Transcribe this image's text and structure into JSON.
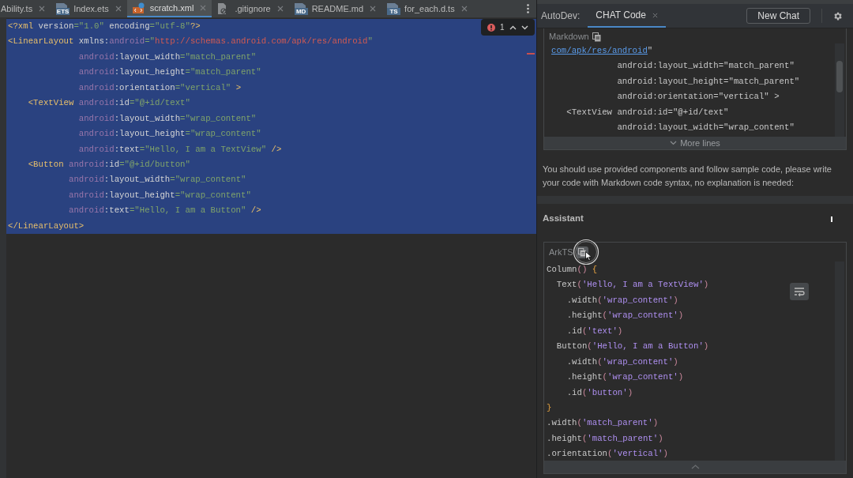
{
  "tabs": [
    {
      "label": "Ability.ts",
      "selected": false
    },
    {
      "label": "Index.ets",
      "selected": false,
      "kind": "ets",
      "icon_label": "ETS"
    },
    {
      "label": "scratch.xml",
      "selected": true,
      "kind": "xml"
    },
    {
      "label": ".gitignore",
      "selected": false,
      "kind": "ignore"
    },
    {
      "label": "README.md",
      "selected": false,
      "kind": "md",
      "icon_label": "MD"
    },
    {
      "label": "for_each.d.ts",
      "selected": false,
      "kind": "ts",
      "icon_label": "TS"
    }
  ],
  "editor": {
    "problems": {
      "count": "1"
    },
    "lines": [
      {
        "selected": true,
        "tokens": [
          {
            "kind": "tag",
            "text": "<?xml "
          },
          {
            "kind": "attr",
            "text": "version"
          },
          {
            "kind": "string",
            "text": "=\"1.0\""
          },
          {
            "kind": "attr",
            "text": " encoding"
          },
          {
            "kind": "string",
            "text": "=\"utf-8\""
          },
          {
            "kind": "tag",
            "text": "?>"
          }
        ]
      },
      {
        "selected": true,
        "tokens": [
          {
            "kind": "tag",
            "text": "<LinearLayout "
          },
          {
            "kind": "attr",
            "text": "xmlns:"
          },
          {
            "kind": "ns",
            "text": "android"
          },
          {
            "kind": "string",
            "text": "=\""
          },
          {
            "kind": "url",
            "text": "http://schemas.android.com/apk/res/android"
          },
          {
            "kind": "string",
            "text": "\""
          }
        ]
      },
      {
        "selected": true,
        "tokens": [
          {
            "kind": "ns",
            "text": "              android"
          },
          {
            "kind": "attr",
            "text": ":layout_width"
          },
          {
            "kind": "string",
            "text": "=\"match_parent\""
          }
        ]
      },
      {
        "selected": true,
        "tokens": [
          {
            "kind": "ns",
            "text": "              android"
          },
          {
            "kind": "attr",
            "text": ":layout_height"
          },
          {
            "kind": "string",
            "text": "=\"match_parent\""
          }
        ]
      },
      {
        "selected": true,
        "tokens": [
          {
            "kind": "ns",
            "text": "              android"
          },
          {
            "kind": "attr",
            "text": ":orientation"
          },
          {
            "kind": "string",
            "text": "=\"vertical\""
          },
          {
            "kind": "tag",
            "text": " >"
          }
        ]
      },
      {
        "selected": true,
        "tokens": [
          {
            "kind": "tag",
            "text": "    <TextView "
          },
          {
            "kind": "ns",
            "text": "android"
          },
          {
            "kind": "attr",
            "text": ":id"
          },
          {
            "kind": "string",
            "text": "=\"@+id/text\""
          }
        ]
      },
      {
        "selected": true,
        "tokens": [
          {
            "kind": "ns",
            "text": "              android"
          },
          {
            "kind": "attr",
            "text": ":layout_width"
          },
          {
            "kind": "string",
            "text": "=\"wrap_content\""
          }
        ]
      },
      {
        "selected": true,
        "tokens": [
          {
            "kind": "ns",
            "text": "              android"
          },
          {
            "kind": "attr",
            "text": ":layout_height"
          },
          {
            "kind": "string",
            "text": "=\"wrap_content\""
          }
        ]
      },
      {
        "selected": true,
        "tokens": [
          {
            "kind": "ns",
            "text": "              android"
          },
          {
            "kind": "attr",
            "text": ":text"
          },
          {
            "kind": "string",
            "text": "=\"Hello, I am a TextView\""
          },
          {
            "kind": "tag",
            "text": " />"
          }
        ]
      },
      {
        "selected": true,
        "tokens": [
          {
            "kind": "tag",
            "text": "    <Button "
          },
          {
            "kind": "ns",
            "text": "android"
          },
          {
            "kind": "attr",
            "text": ":id"
          },
          {
            "kind": "string",
            "text": "=\"@+id/button\""
          }
        ]
      },
      {
        "selected": true,
        "tokens": [
          {
            "kind": "ns",
            "text": "            android"
          },
          {
            "kind": "attr",
            "text": ":layout_width"
          },
          {
            "kind": "string",
            "text": "=\"wrap_content\""
          }
        ]
      },
      {
        "selected": true,
        "tokens": [
          {
            "kind": "ns",
            "text": "            android"
          },
          {
            "kind": "attr",
            "text": ":layout_height"
          },
          {
            "kind": "string",
            "text": "=\"wrap_content\""
          }
        ]
      },
      {
        "selected": true,
        "tokens": [
          {
            "kind": "ns",
            "text": "            android"
          },
          {
            "kind": "attr",
            "text": ":text"
          },
          {
            "kind": "string",
            "text": "=\"Hello, I am a Button\""
          },
          {
            "kind": "tag",
            "text": " />"
          }
        ]
      },
      {
        "selected": true,
        "tokens": [
          {
            "kind": "tag",
            "text": "</LinearLayout>"
          }
        ]
      }
    ]
  },
  "chat": {
    "title": "AutoDev:",
    "tabs": [
      {
        "label": "CHAT Code",
        "selected": true
      }
    ],
    "new_chat_button": "New Chat",
    "messages": [
      {
        "kind": "user",
        "code_block": {
          "language": "Markdown",
          "footer": "More lines",
          "lines": [
            [
              {
                "kind": "link",
                "text": "com/apk/res/android"
              },
              {
                "kind": "plain",
                "text": "\""
              }
            ],
            [
              {
                "kind": "plain",
                "text": "             android:layout_width=\"match_parent\""
              }
            ],
            [
              {
                "kind": "plain",
                "text": "             android:layout_height=\"match_parent\""
              }
            ],
            [
              {
                "kind": "plain",
                "text": "             android:orientation=\"vertical\" >"
              }
            ],
            [
              {
                "kind": "plain",
                "text": "   <TextView android:id=\"@+id/text\""
              }
            ],
            [
              {
                "kind": "plain",
                "text": "             android:layout_width=\"wrap_content\""
              }
            ]
          ]
        },
        "text": "You should use provided components and follow sample code, please write your code with Markdown code syntax, no explanation is needed:"
      },
      {
        "kind": "assistant",
        "author": "Assistant",
        "code_block": {
          "language": "ArkTS",
          "lines": [
            [
              {
                "kind": "plain",
                "text": "Column"
              },
              {
                "kind": "paren",
                "text": "()"
              },
              {
                "kind": "brace",
                "text": " {"
              }
            ],
            [
              {
                "kind": "plain",
                "text": "  Text"
              },
              {
                "kind": "paren",
                "text": "("
              },
              {
                "kind": "string",
                "text": "'Hello, I am a TextView'"
              },
              {
                "kind": "paren",
                "text": ")"
              }
            ],
            [
              {
                "kind": "plain",
                "text": "    .width"
              },
              {
                "kind": "paren",
                "text": "("
              },
              {
                "kind": "string",
                "text": "'wrap_content'"
              },
              {
                "kind": "paren",
                "text": ")"
              }
            ],
            [
              {
                "kind": "plain",
                "text": "    .height"
              },
              {
                "kind": "paren",
                "text": "("
              },
              {
                "kind": "string",
                "text": "'wrap_content'"
              },
              {
                "kind": "paren",
                "text": ")"
              }
            ],
            [
              {
                "kind": "plain",
                "text": "    .id"
              },
              {
                "kind": "paren",
                "text": "("
              },
              {
                "kind": "string",
                "text": "'text'"
              },
              {
                "kind": "paren",
                "text": ")"
              }
            ],
            [
              {
                "kind": "plain",
                "text": "  Button"
              },
              {
                "kind": "paren",
                "text": "("
              },
              {
                "kind": "string",
                "text": "'Hello, I am a Button'"
              },
              {
                "kind": "paren",
                "text": ")"
              }
            ],
            [
              {
                "kind": "plain",
                "text": "    .width"
              },
              {
                "kind": "paren",
                "text": "("
              },
              {
                "kind": "string",
                "text": "'wrap_content'"
              },
              {
                "kind": "paren",
                "text": ")"
              }
            ],
            [
              {
                "kind": "plain",
                "text": "    .height"
              },
              {
                "kind": "paren",
                "text": "("
              },
              {
                "kind": "string",
                "text": "'wrap_content'"
              },
              {
                "kind": "paren",
                "text": ")"
              }
            ],
            [
              {
                "kind": "plain",
                "text": "    .id"
              },
              {
                "kind": "paren",
                "text": "("
              },
              {
                "kind": "string",
                "text": "'button'"
              },
              {
                "kind": "paren",
                "text": ")"
              }
            ],
            [
              {
                "kind": "brace",
                "text": "}"
              }
            ],
            [
              {
                "kind": "plain",
                "text": ".width"
              },
              {
                "kind": "paren",
                "text": "("
              },
              {
                "kind": "string",
                "text": "'match_parent'"
              },
              {
                "kind": "paren",
                "text": ")"
              }
            ],
            [
              {
                "kind": "plain",
                "text": ".height"
              },
              {
                "kind": "paren",
                "text": "("
              },
              {
                "kind": "string",
                "text": "'match_parent'"
              },
              {
                "kind": "paren",
                "text": ")"
              }
            ],
            [
              {
                "kind": "plain",
                "text": ".orientation"
              },
              {
                "kind": "paren",
                "text": "("
              },
              {
                "kind": "string",
                "text": "'vertical'"
              },
              {
                "kind": "paren",
                "text": ")"
              }
            ]
          ]
        }
      }
    ]
  }
}
